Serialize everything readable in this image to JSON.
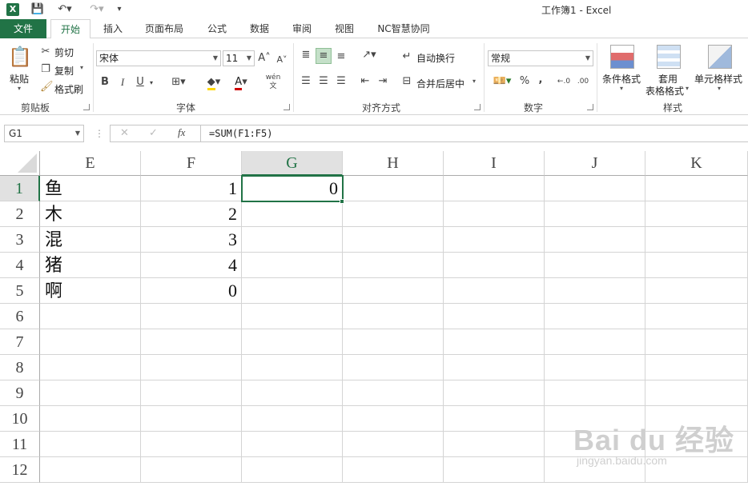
{
  "window": {
    "title": "工作簿1 - Excel",
    "app_icon": "X"
  },
  "ribbon_tabs": [
    "文件",
    "开始",
    "插入",
    "页面布局",
    "公式",
    "数据",
    "审阅",
    "视图",
    "NC智慧协同"
  ],
  "active_tab": "开始",
  "clipboard": {
    "paste": "粘贴",
    "cut": "剪切",
    "copy": "复制",
    "format_painter": "格式刷",
    "label": "剪贴板"
  },
  "font": {
    "name": "宋体",
    "size": "11",
    "bold": "B",
    "italic": "I",
    "underline": "U",
    "phonetic": "wén",
    "label": "字体"
  },
  "alignment": {
    "wrap_text": "自动换行",
    "merge_center": "合并后居中",
    "label": "对齐方式"
  },
  "number": {
    "format": "常规",
    "percent": "%",
    "comma": ",",
    "label": "数字"
  },
  "styles": {
    "conditional_format": "条件格式",
    "table_format_line1": "套用",
    "table_format_line2": "表格格式",
    "cell_styles": "单元格样式",
    "label": "样式"
  },
  "formula_bar": {
    "name_box": "G1",
    "fx": "fx",
    "formula": "=SUM(F1:F5)"
  },
  "sheet": {
    "columns": [
      "E",
      "F",
      "G",
      "H",
      "I",
      "J",
      "K"
    ],
    "selected_column": "G",
    "rows": [
      "1",
      "2",
      "3",
      "4",
      "5",
      "6",
      "7",
      "8",
      "9",
      "10",
      "11",
      "12"
    ],
    "selected_row": "1",
    "active_cell": "G1",
    "cells": {
      "E": [
        "鱼",
        "木",
        "混",
        "猪",
        "啊"
      ],
      "F": [
        "1",
        "2",
        "3",
        "4",
        "0"
      ],
      "G": [
        "0"
      ]
    }
  },
  "watermark": {
    "main": "Bai du 经验",
    "sub": "jingyan.baidu.com"
  },
  "colors": {
    "excel_green": "#217346",
    "header_gray": "#e1e1e1",
    "grid_line": "#d4d4d4"
  }
}
